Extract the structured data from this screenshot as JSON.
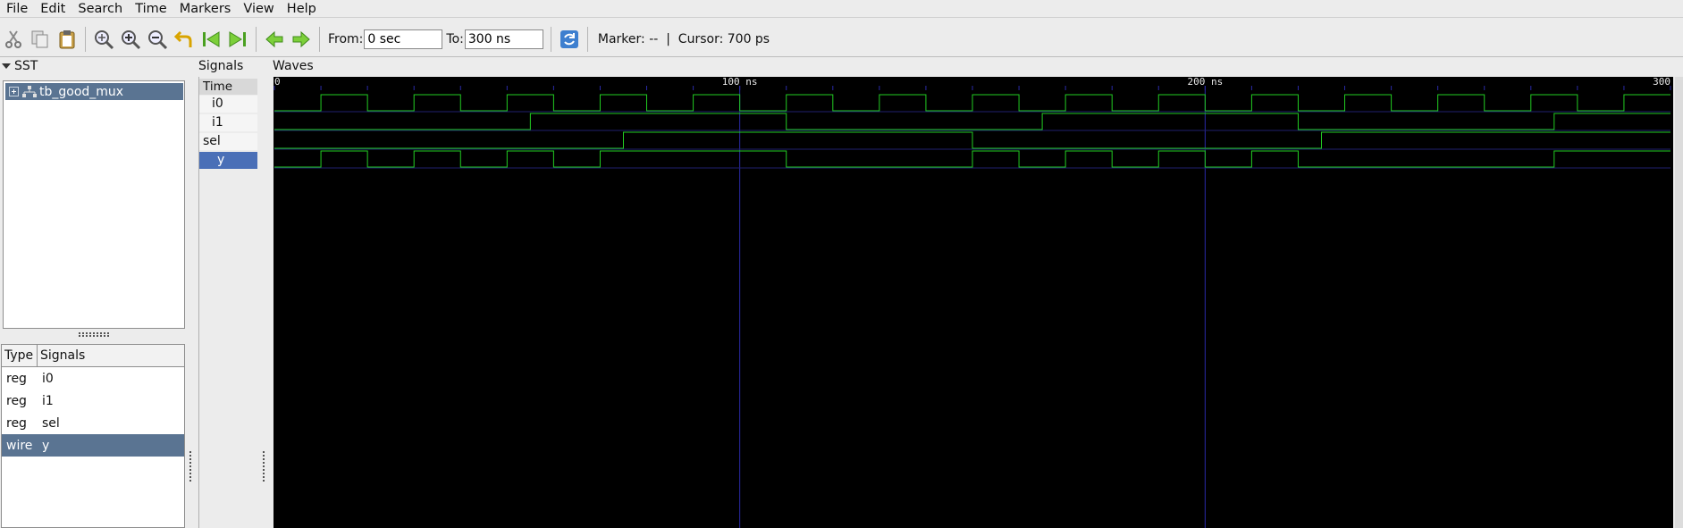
{
  "menu": [
    "File",
    "Edit",
    "Search",
    "Time",
    "Markers",
    "View",
    "Help"
  ],
  "toolbar": {
    "from_label": "From:",
    "from_value": "0 sec",
    "to_label": "To:",
    "to_value": "300 ns",
    "marker_text": "Marker: --  |  Cursor: 700 ps"
  },
  "sst": {
    "title": "SST",
    "tree_item": "tb_good_mux"
  },
  "signal_list": {
    "header_type": "Type",
    "header_signals": "Signals",
    "rows": [
      {
        "type": "reg",
        "name": "i0"
      },
      {
        "type": "reg",
        "name": "i1"
      },
      {
        "type": "reg",
        "name": "sel"
      },
      {
        "type": "wire",
        "name": "y"
      }
    ]
  },
  "signals_pane": {
    "title": "Signals",
    "time_label": "Time",
    "names": [
      "i0",
      "i1",
      "sel",
      "y"
    ]
  },
  "waves": {
    "title": "Waves",
    "time_start_ns": 0,
    "time_end_ns": 300,
    "tick_labels": [
      {
        "t": 0,
        "label": "0"
      },
      {
        "t": 100,
        "label": "100 ns"
      },
      {
        "t": 200,
        "label": "200 ns"
      },
      {
        "t": 300,
        "label": "300"
      }
    ],
    "minor_tick_ns": 10,
    "wave_color": "#22cc22",
    "grid_color": "#2a2aa8",
    "signals": [
      {
        "name": "i0",
        "initial": 0,
        "transitions_ns": [
          10,
          20,
          30,
          40,
          50,
          60,
          70,
          80,
          90,
          100,
          110,
          120,
          130,
          140,
          150,
          160,
          170,
          180,
          190,
          200,
          210,
          220,
          230,
          240,
          250,
          260,
          270,
          280,
          290
        ]
      },
      {
        "name": "i1",
        "initial": 0,
        "transitions_ns": [
          55,
          110,
          165,
          220,
          275
        ]
      },
      {
        "name": "sel",
        "initial": 0,
        "transitions_ns": [
          75,
          150,
          225
        ]
      },
      {
        "name": "y",
        "initial": 0,
        "transitions_ns": [
          10,
          20,
          30,
          40,
          50,
          60,
          70,
          110,
          150,
          160,
          170,
          180,
          190,
          200,
          210,
          220,
          275
        ]
      }
    ]
  }
}
